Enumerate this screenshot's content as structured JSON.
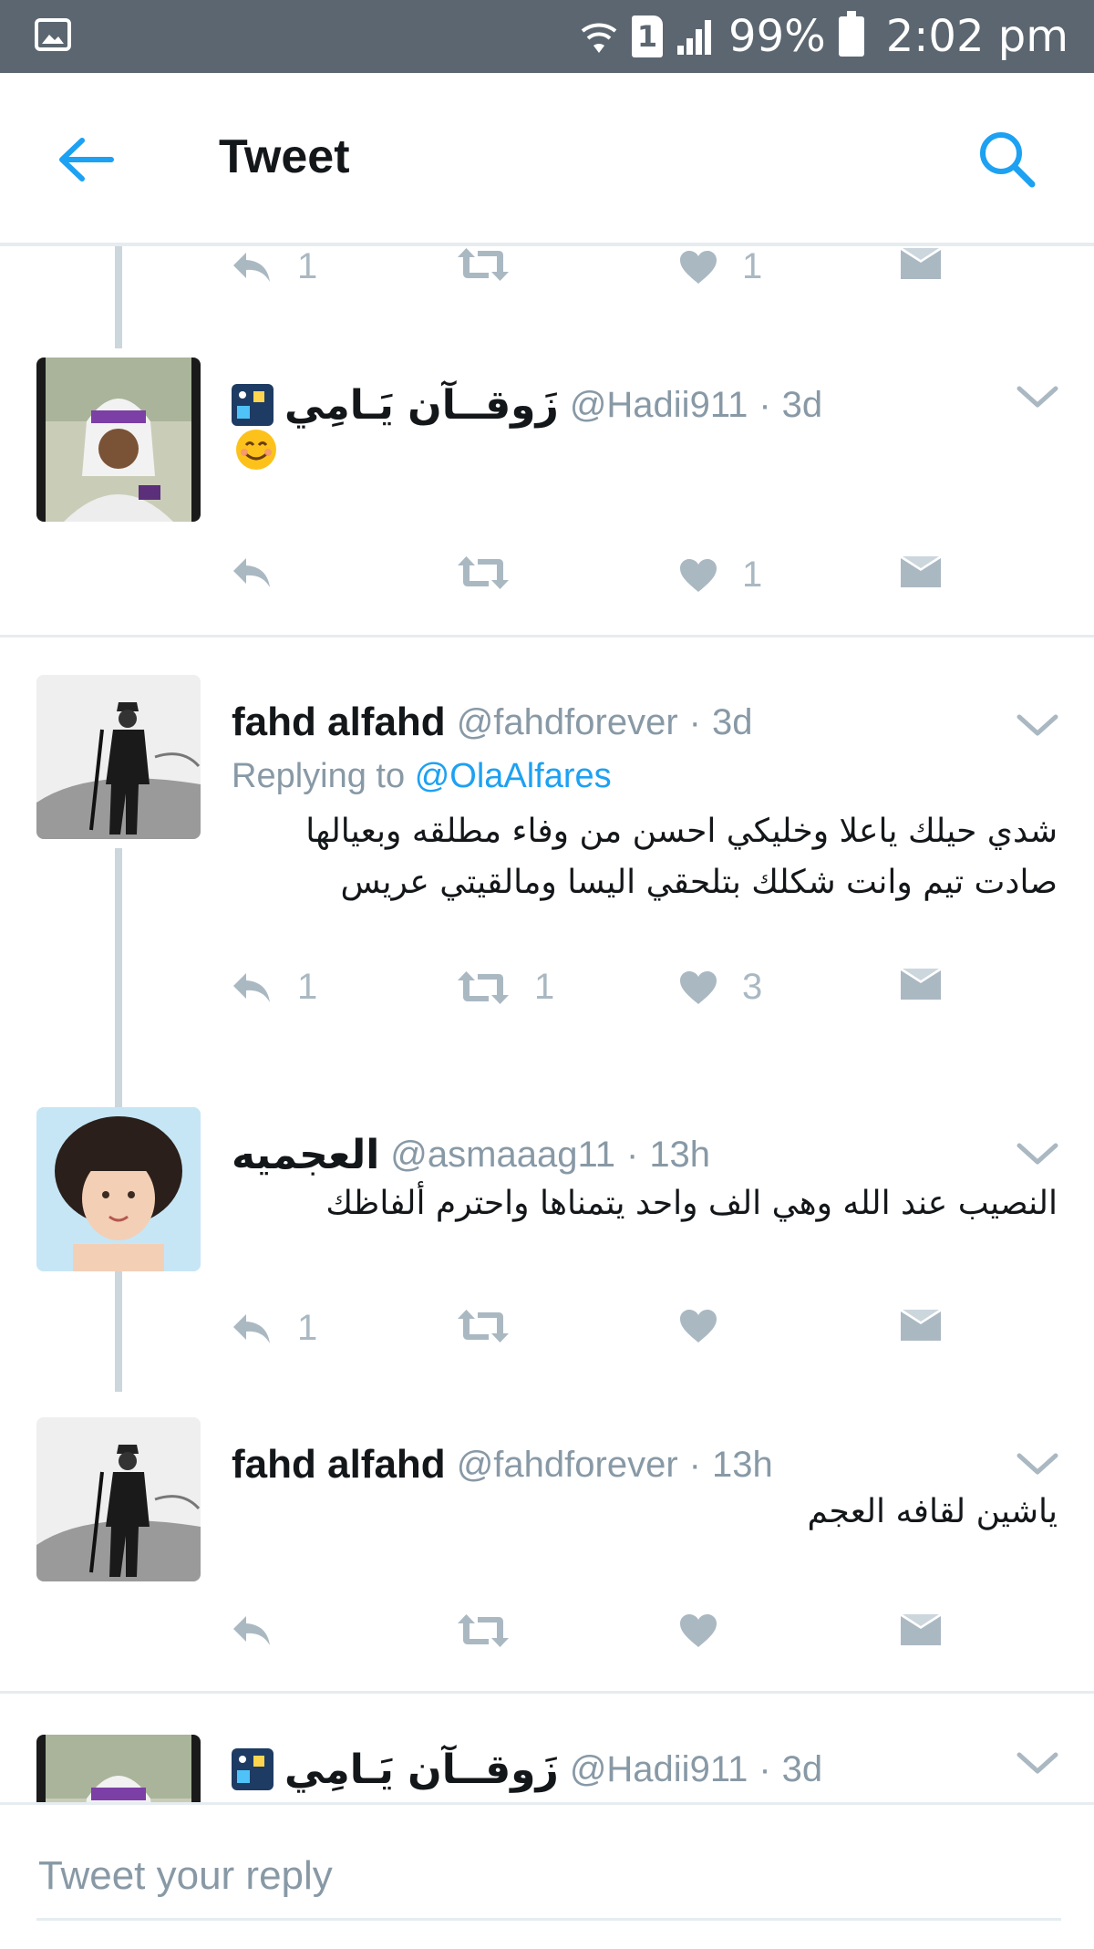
{
  "status_bar": {
    "battery": "99%",
    "time": "2:02 pm",
    "sim": "1"
  },
  "header": {
    "title": "Tweet"
  },
  "top_actions": {
    "reply_count": "1",
    "retweet_count": "",
    "like_count": "1"
  },
  "tweets": [
    {
      "name": "زَوقــآن يَـامِي",
      "handle": "@Hadii911",
      "time": "3d",
      "body": "",
      "emoji": "smiling-face-icon",
      "reply_count": "",
      "retweet_count": "",
      "like_count": "1"
    },
    {
      "name": "fahd alfahd",
      "handle": "@fahdforever",
      "time": "3d",
      "replying_prefix": "Replying to",
      "replying_to": "@OlaAlfares",
      "body": "شدي حيلك ياعلا وخليكي احسن من وفاء مطلقه وبعيالها صادت تيم وانت شكلك بتلحقي اليسا ومالقيتي عريس",
      "reply_count": "1",
      "retweet_count": "1",
      "like_count": "3"
    },
    {
      "name": "العجميه",
      "handle": "@asmaaag11",
      "time": "13h",
      "body": "النصيب عند الله وهي الف واحد يتمناها واحترم ألفاظك",
      "reply_count": "1",
      "retweet_count": "",
      "like_count": ""
    },
    {
      "name": "fahd alfahd",
      "handle": "@fahdforever",
      "time": "13h",
      "body": "ياشين لقافه العجم",
      "reply_count": "",
      "retweet_count": "",
      "like_count": ""
    },
    {
      "name": "زَوقــآن يَـامِي",
      "handle": "@Hadii911",
      "time": "3d"
    }
  ],
  "separator": "·",
  "composer": {
    "placeholder": "Tweet your reply"
  },
  "colors": {
    "accent": "#1da1f2",
    "status_bar": "#5b6670",
    "muted": "#8899a6",
    "action_gray": "#aab8c2"
  }
}
